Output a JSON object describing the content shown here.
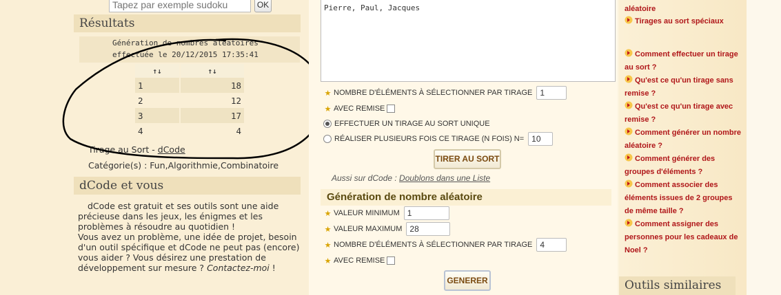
{
  "search": {
    "placeholder": "Tapez par exemple sudoku",
    "ok_label": "OK"
  },
  "results": {
    "title": "Résultats",
    "message_line1": "Génération de nombres aléatoires",
    "message_line2": "effectuée le 20/12/2015 17:35:41",
    "columns": [
      "↑↓",
      "↑↓"
    ],
    "rows": [
      [
        "1",
        "18"
      ],
      [
        "2",
        "12"
      ],
      [
        "3",
        "17"
      ],
      [
        "4",
        "4"
      ]
    ],
    "tool_prefix": "Tirage au Sort - ",
    "tool_link": "dCode",
    "categories": "Catégorie(s) : Fun,Algorithmie,Combinatoire"
  },
  "dcode_vous": {
    "title": "dCode et vous",
    "para1": "dCode est gratuit et ses outils sont une aide précieuse dans les jeux, les énigmes et les problèmes à résoudre au quotidien !",
    "para2": "Vous avez un problème, une idée de projet, besoin d'un outil spécifique et dCode ne peut pas (encore) vous aider ? Vous désirez une prestation de développement sur mesure ?",
    "contact": "Contactez-moi",
    "end": " !"
  },
  "tirage_form": {
    "list_value": "Pierre, Paul, Jacques",
    "count_label": "Nombre d'éléments à sélectionner par tirage",
    "count_value": "1",
    "remise_label": "Avec remise",
    "remise_checked": false,
    "radio_single": "Effectuer un tirage au sort unique",
    "radio_single_checked": true,
    "radio_multi": "Réaliser plusieurs fois ce tirage (N fois) N=",
    "radio_multi_value": "10",
    "submit": "TIRER AU SORT",
    "also_prefix": "Aussi sur dCode : ",
    "also_link": "Doublons dans une Liste"
  },
  "nombre_form": {
    "title": "Génération de nombre aléatoire",
    "min_label": "Valeur minimum",
    "min_value": "1",
    "max_label": "Valeur maximum",
    "max_value": "28",
    "count_label": "Nombre d'éléments à sélectionner par tirage",
    "count_value": "4",
    "remise_label": "Avec remise",
    "remise_checked": false,
    "submit": "GENERER"
  },
  "sidebar": {
    "faq": [
      "aléatoire",
      "Tirages au sort spéciaux",
      "Comment effectuer un tirage au sort ?",
      "Qu'est ce qu'un tirage sans remise ?",
      "Qu'est ce qu'un tirage avec remise ?",
      "Comment générer un nombre aléatoire ?",
      "Comment générer des groupes d'éléments ?",
      "Comment associer des éléments issues de 2 groupes de même taille ?",
      "Comment assigner des personnes pour les cadeaux de Noel ?"
    ],
    "similar_title": "Outils similaires"
  },
  "colors": {
    "accent_red": "#b0171a",
    "star": "#d9a400",
    "section_bg": "#efe0bb"
  }
}
